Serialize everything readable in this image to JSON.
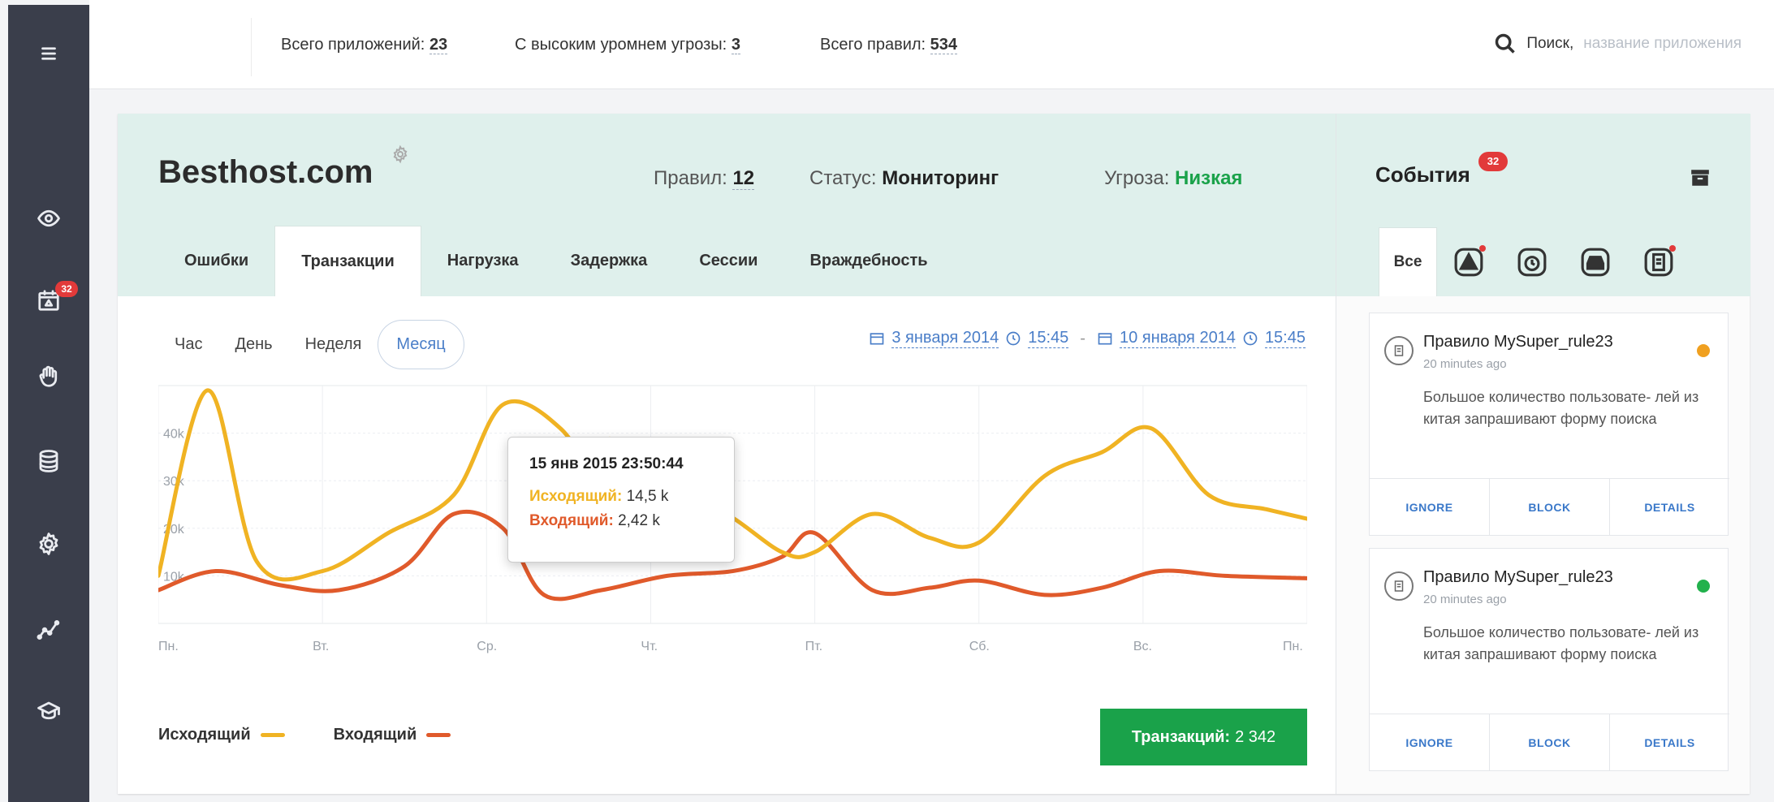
{
  "sidebar": {
    "badge": "32",
    "items": [
      "menu-icon",
      "eye-icon",
      "calendar-alert-icon",
      "hand-icon",
      "database-icon",
      "gear-icon",
      "analytics-icon",
      "graduation-cap-icon"
    ]
  },
  "topbar": {
    "total_apps_label": "Всего приложений:",
    "total_apps_value": "23",
    "high_threat_label": "С высоким уромнем угрозы:",
    "high_threat_value": "3",
    "total_rules_label": "Всего правил:",
    "total_rules_value": "534",
    "search_label": "Поиск,",
    "search_placeholder": "название приложения"
  },
  "app": {
    "title": "Besthost.com",
    "rules_label": "Правил:",
    "rules_value": "12",
    "status_label": "Статус:",
    "status_value": "Мониторинг",
    "threat_label": "Угроза:",
    "threat_value": "Низкая"
  },
  "tabs": [
    "Ошибки",
    "Транзакции",
    "Нагрузка",
    "Задержка",
    "Сессии",
    "Враждебность"
  ],
  "active_tab": "Транзакции",
  "range": {
    "options": [
      "Час",
      "День",
      "Неделя",
      "Месяц"
    ],
    "active": "Месяц",
    "from_date": "3 января 2014",
    "from_time": "15:45",
    "separator": "-",
    "to_date": "10 января 2014",
    "to_time": "15:45"
  },
  "chart_data": {
    "type": "line",
    "x": [
      "Пн.",
      "Вт.",
      "Ср.",
      "Чт.",
      "Пт.",
      "Сб.",
      "Вс.",
      "Пн."
    ],
    "y_ticks": [
      "10k",
      "20k",
      "30k",
      "40k"
    ],
    "ylim": [
      0,
      50000
    ],
    "series": [
      {
        "name": "Исходящий",
        "color": "#f0b323",
        "x": [
          0,
          0.3,
          0.6,
          1.0,
          1.4,
          1.8,
          2.1,
          2.45,
          2.75,
          3.0,
          3.4,
          3.8,
          4.0,
          4.35,
          4.7,
          5.0,
          5.4,
          5.75,
          6.05,
          6.4,
          6.75,
          7.0
        ],
        "values": [
          10000,
          49000,
          13000,
          11000,
          19000,
          27000,
          46000,
          41000,
          26000,
          25000,
          24000,
          15000,
          15000,
          23000,
          18000,
          17000,
          31000,
          36000,
          41000,
          27000,
          24000,
          22000
        ]
      },
      {
        "name": "Входящий",
        "color": "#e05a2b",
        "x": [
          0,
          0.35,
          0.75,
          1.1,
          1.5,
          1.8,
          2.1,
          2.35,
          2.7,
          3.1,
          3.5,
          3.8,
          4.0,
          4.35,
          4.7,
          5.0,
          5.4,
          5.75,
          6.1,
          6.5,
          7.0
        ],
        "values": [
          7000,
          11000,
          8000,
          7000,
          12000,
          23000,
          20000,
          6000,
          7000,
          10000,
          11000,
          14000,
          19000,
          7000,
          7500,
          9000,
          6000,
          7500,
          11000,
          10000,
          9500
        ]
      }
    ],
    "tooltip": {
      "date": "15 янв 2015 23:50:44",
      "out_label": "Исходящий:",
      "out_value": "14,5 k",
      "in_label": "Входящий:",
      "in_value": "2,42 k"
    }
  },
  "legend": {
    "out_label": "Исходящий",
    "in_label": "Входящий"
  },
  "transactions": {
    "label": "Транзакций:",
    "value": "2 342"
  },
  "events": {
    "title": "События",
    "badge": "32",
    "tabs": [
      "Все"
    ],
    "tab_icons": [
      "warning-icon",
      "alarm-icon",
      "inbox-icon",
      "document-icon"
    ],
    "cards": [
      {
        "title": "Правило MySuper_rule23",
        "time": "20 minutes ago",
        "desc": "Большое количество пользовате- лей из китая запрашивают форму поиска",
        "status_color": "#f0a020",
        "ignore": "IGNORE",
        "block": "BLOCK",
        "details": "DETAILS"
      },
      {
        "title": "Правило MySuper_rule23",
        "time": "20 minutes ago",
        "desc": "Большое количество пользовате- лей из китая запрашивают форму поиска",
        "status_color": "#22b14c",
        "ignore": "IGNORE",
        "block": "BLOCK",
        "details": "DETAILS"
      }
    ]
  }
}
